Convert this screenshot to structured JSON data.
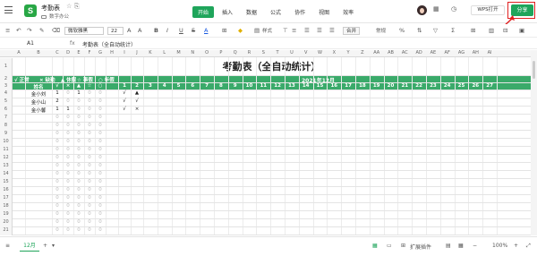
{
  "app": {
    "title": "考勤表",
    "folder": "数字办公",
    "logo": "S"
  },
  "tabs": [
    "开始",
    "插入",
    "数据",
    "公式",
    "协作",
    "视图",
    "效率"
  ],
  "active_tab": "开始",
  "header": {
    "open_label": "WPS打开",
    "share_label": "分享"
  },
  "toolbar": {
    "font_name": "微软雅黑",
    "font_size": "22",
    "style_label": "样式",
    "merge_label": "合并",
    "format_label": "常规"
  },
  "formula_bar": {
    "cell_ref": "A1",
    "fx": "fx",
    "value": "考勤表（全自动统计）"
  },
  "columns": [
    "A",
    "B",
    "C",
    "D",
    "E",
    "F",
    "G",
    "H",
    "I",
    "J",
    "K",
    "L",
    "M",
    "N",
    "O",
    "P",
    "Q",
    "R",
    "S",
    "T",
    "U",
    "V",
    "W",
    "X",
    "Y",
    "Z",
    "AA",
    "AB",
    "AC",
    "AD",
    "AE",
    "AF",
    "AG",
    "AH",
    "AI"
  ],
  "rows": [
    "1",
    "2",
    "3",
    "4",
    "5",
    "6",
    "7",
    "8",
    "9",
    "10",
    "11",
    "12",
    "13",
    "14",
    "15",
    "16",
    "17",
    "18",
    "19",
    "20",
    "21",
    "22"
  ],
  "sheet": {
    "title": "考勤表（全自动统计）",
    "legend": [
      "√ 正常",
      "× 缺勤",
      "▲ 休假",
      "☆ 事假",
      "○ 年假"
    ],
    "header2": [
      "姓名",
      "√",
      "×",
      "▲",
      "☆",
      "○"
    ],
    "month": "2021年12月",
    "days": [
      "1",
      "2",
      "3",
      "4",
      "5",
      "6",
      "7",
      "8",
      "9",
      "10",
      "11",
      "12",
      "13",
      "14",
      "15",
      "16",
      "17",
      "18",
      "19",
      "20",
      "21",
      "22",
      "23",
      "24",
      "25",
      "26",
      "27",
      "28",
      "29",
      "30"
    ],
    "people": [
      {
        "name": "金小刘",
        "counts": [
          "1",
          "0",
          "1",
          "0",
          "0"
        ],
        "d1": "√",
        "d2": "▲"
      },
      {
        "name": "金小山",
        "counts": [
          "2",
          "0",
          "0",
          "0",
          "0"
        ],
        "d1": "√",
        "d2": "√"
      },
      {
        "name": "金小馨",
        "counts": [
          "1",
          "1",
          "0",
          "0",
          "0"
        ],
        "d1": "√",
        "d2": "×"
      }
    ],
    "zero": "0"
  },
  "bottom": {
    "sheet_tab": "12月",
    "add": "+",
    "ext_label": "扩展插件",
    "zoom": "100%"
  },
  "colors": {
    "green": "#1fa55b",
    "header_green": "#3aaa6a",
    "highlight_red": "#e02020"
  }
}
